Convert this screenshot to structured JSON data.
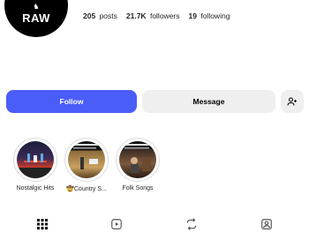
{
  "profile": {
    "avatar_text": "RAW",
    "stats": {
      "posts_value": "205",
      "posts_label": "posts",
      "followers_value": "21.7K",
      "followers_label": "followers",
      "following_value": "19",
      "following_label": "following"
    }
  },
  "actions": {
    "follow_label": "Follow",
    "message_label": "Message",
    "suggest_icon": "person-add-icon"
  },
  "highlights": [
    {
      "label": "Nostalgic Hits"
    },
    {
      "label": "🤠Country S..."
    },
    {
      "label": "Folk Songs"
    }
  ],
  "tabs": [
    {
      "icon": "grid-icon"
    },
    {
      "icon": "reels-icon"
    },
    {
      "icon": "repost-icon"
    },
    {
      "icon": "tagged-icon"
    }
  ],
  "colors": {
    "accent": "#4a5df9",
    "secondary_button": "#efefef"
  }
}
